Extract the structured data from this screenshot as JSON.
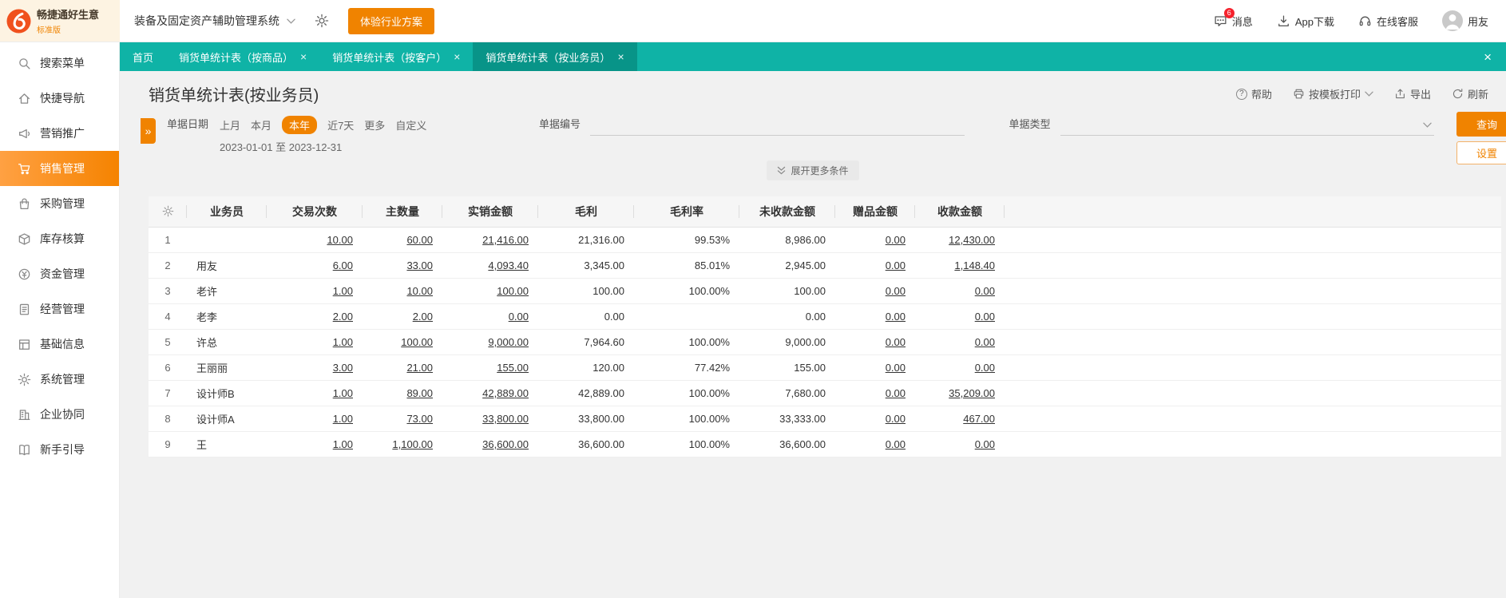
{
  "topbar": {
    "logo_title": "畅捷通好生意",
    "logo_subtitle": "标准版",
    "system_select": "装备及固定资产辅助管理系统",
    "trial_button": "体验行业方案",
    "messages": {
      "label": "消息",
      "badge": "6"
    },
    "app_download": "App下载",
    "online_service": "在线客服",
    "username": "用友"
  },
  "tabs": [
    {
      "label": "首页",
      "closable": false,
      "active": false
    },
    {
      "label": "销货单统计表（按商品）",
      "closable": true,
      "active": false
    },
    {
      "label": "销货单统计表（按客户）",
      "closable": true,
      "active": false
    },
    {
      "label": "销货单统计表（按业务员）",
      "closable": true,
      "active": true
    }
  ],
  "sidebar": {
    "items": [
      {
        "label": "搜索菜单",
        "icon": "search-icon",
        "active": false
      },
      {
        "label": "快捷导航",
        "icon": "home-icon",
        "active": false
      },
      {
        "label": "营销推广",
        "icon": "megaphone-icon",
        "active": false
      },
      {
        "label": "销售管理",
        "icon": "cart-icon",
        "active": true
      },
      {
        "label": "采购管理",
        "icon": "bag-icon",
        "active": false
      },
      {
        "label": "库存核算",
        "icon": "box-icon",
        "active": false
      },
      {
        "label": "资金管理",
        "icon": "coin-icon",
        "active": false
      },
      {
        "label": "经营管理",
        "icon": "clipboard-icon",
        "active": false
      },
      {
        "label": "基础信息",
        "icon": "grid-icon",
        "active": false
      },
      {
        "label": "系统管理",
        "icon": "gear-icon",
        "active": false
      },
      {
        "label": "企业协同",
        "icon": "building-icon",
        "active": false
      },
      {
        "label": "新手引导",
        "icon": "book-icon",
        "active": false
      }
    ]
  },
  "page": {
    "title": "销货单统计表(按业务员)",
    "toolbar": {
      "help": "帮助",
      "print": "按模板打印",
      "export": "导出",
      "refresh": "刷新"
    }
  },
  "filters": {
    "date_label": "单据日期",
    "date_options": [
      "上月",
      "本月",
      "本年",
      "近7天",
      "更多",
      "自定义"
    ],
    "date_selected": "本年",
    "date_range": "2023-01-01 至 2023-12-31",
    "doc_no_label": "单据编号",
    "doc_type_label": "单据类型",
    "search_button": "查询",
    "settings_button": "设置",
    "expand_more": "展开更多条件"
  },
  "table": {
    "columns": [
      "业务员",
      "交易次数",
      "主数量",
      "实销金额",
      "毛利",
      "毛利率",
      "未收款金额",
      "赠品金额",
      "收款金额"
    ],
    "link_value_columns": [
      0,
      1,
      2,
      6,
      7
    ],
    "rows": [
      {
        "no": "1",
        "name": "",
        "values": [
          "10.00",
          "60.00",
          "21,416.00",
          "21,316.00",
          "99.53%",
          "8,986.00",
          "0.00",
          "12,430.00"
        ]
      },
      {
        "no": "2",
        "name": "用友",
        "values": [
          "6.00",
          "33.00",
          "4,093.40",
          "3,345.00",
          "85.01%",
          "2,945.00",
          "0.00",
          "1,148.40"
        ]
      },
      {
        "no": "3",
        "name": "老许",
        "values": [
          "1.00",
          "10.00",
          "100.00",
          "100.00",
          "100.00%",
          "100.00",
          "0.00",
          "0.00"
        ]
      },
      {
        "no": "4",
        "name": "老李",
        "values": [
          "2.00",
          "2.00",
          "0.00",
          "0.00",
          "",
          "0.00",
          "0.00",
          "0.00"
        ]
      },
      {
        "no": "5",
        "name": "许总",
        "values": [
          "1.00",
          "100.00",
          "9,000.00",
          "7,964.60",
          "100.00%",
          "9,000.00",
          "0.00",
          "0.00"
        ]
      },
      {
        "no": "6",
        "name": "王丽丽",
        "values": [
          "3.00",
          "21.00",
          "155.00",
          "120.00",
          "77.42%",
          "155.00",
          "0.00",
          "0.00"
        ]
      },
      {
        "no": "7",
        "name": "设计师B",
        "values": [
          "1.00",
          "89.00",
          "42,889.00",
          "42,889.00",
          "100.00%",
          "7,680.00",
          "0.00",
          "35,209.00"
        ]
      },
      {
        "no": "8",
        "name": "设计师A",
        "values": [
          "1.00",
          "73.00",
          "33,800.00",
          "33,800.00",
          "100.00%",
          "33,333.00",
          "0.00",
          "467.00"
        ]
      },
      {
        "no": "9",
        "name": "王",
        "values": [
          "1.00",
          "1,100.00",
          "36,600.00",
          "36,600.00",
          "100.00%",
          "36,600.00",
          "0.00",
          "0.00"
        ]
      }
    ]
  },
  "colors": {
    "teal": "#0fb3a6",
    "teal_active_tab": "#089488",
    "orange": "#f08300",
    "badge_red": "#f5222d"
  }
}
